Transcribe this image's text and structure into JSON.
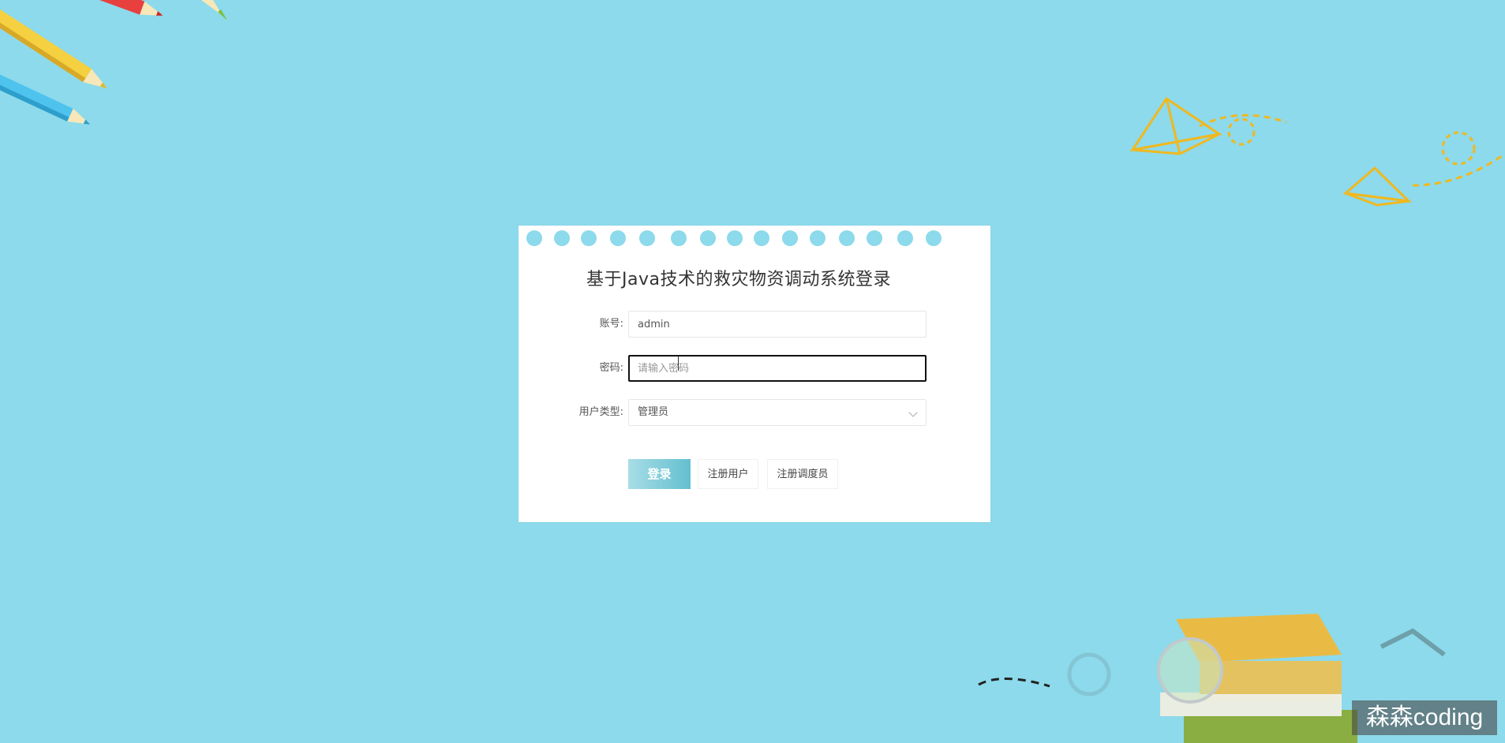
{
  "colors": {
    "background": "#8cdaeb",
    "accent": "#64bfcf",
    "card": "#ffffff"
  },
  "form": {
    "title": "基于Java技术的救灾物资调动系统登录",
    "account_label": "账号:",
    "account_value": "admin",
    "password_label": "密码:",
    "password_placeholder": "请输入密码",
    "role_label": "用户类型:",
    "role_value": "管理员"
  },
  "buttons": {
    "login": "登录",
    "register_user": "注册用户",
    "register_dispatcher": "注册调度员"
  },
  "watermark": "森森coding"
}
